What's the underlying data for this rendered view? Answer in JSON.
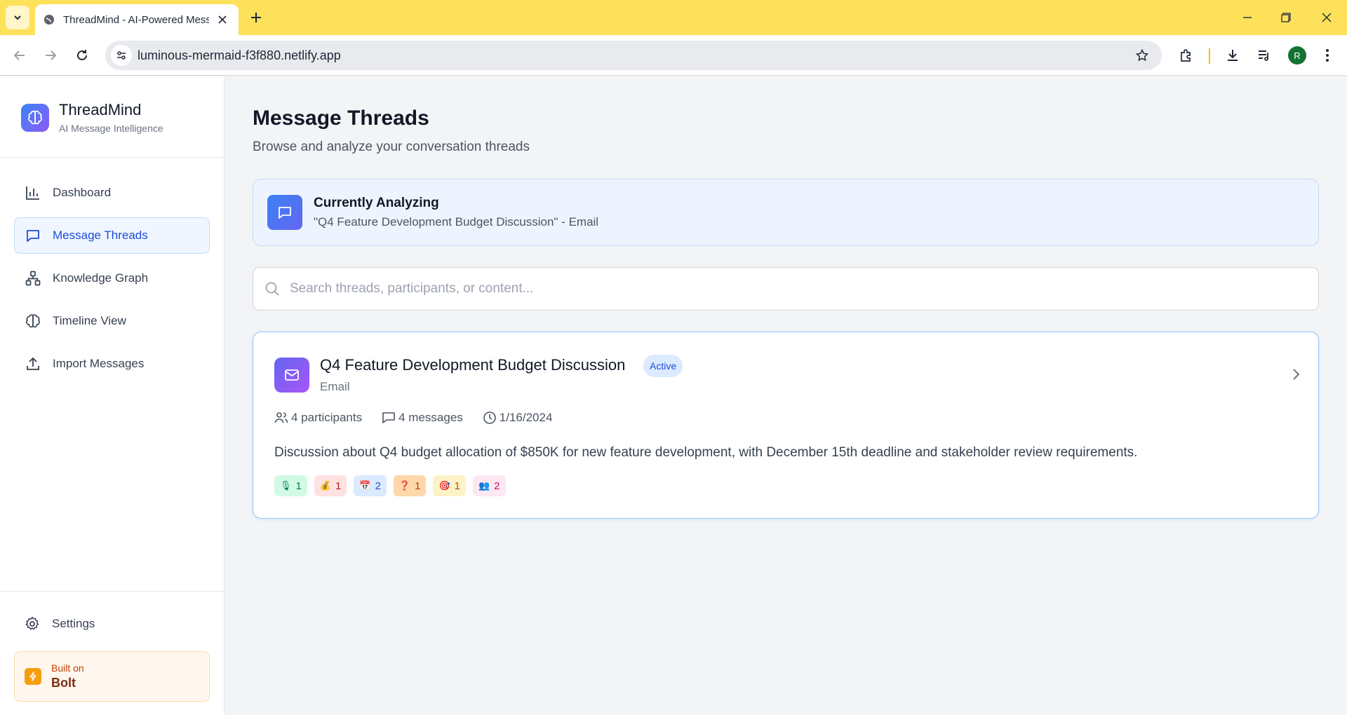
{
  "browser": {
    "tab_title": "ThreadMind - AI-Powered Mess",
    "url": "luminous-mermaid-f3f880.netlify.app",
    "profile_initial": "R"
  },
  "brand": {
    "title": "ThreadMind",
    "subtitle": "AI Message Intelligence"
  },
  "nav": [
    {
      "label": "Dashboard",
      "icon": "bar-chart-icon",
      "active": false
    },
    {
      "label": "Message Threads",
      "icon": "message-square-icon",
      "active": true
    },
    {
      "label": "Knowledge Graph",
      "icon": "network-icon",
      "active": false
    },
    {
      "label": "Timeline View",
      "icon": "brain-icon",
      "active": false
    },
    {
      "label": "Import Messages",
      "icon": "upload-icon",
      "active": false
    }
  ],
  "settings_label": "Settings",
  "bolt": {
    "small": "Built on",
    "big": "Bolt"
  },
  "page": {
    "title": "Message Threads",
    "subtitle": "Browse and analyze your conversation threads"
  },
  "analyzing": {
    "title": "Currently Analyzing",
    "subtitle": "\"Q4 Feature Development Budget Discussion\" - Email"
  },
  "search": {
    "placeholder": "Search threads, participants, or content...",
    "value": ""
  },
  "thread": {
    "title": "Q4 Feature Development Budget Discussion",
    "badge": "Active",
    "type": "Email",
    "participants": "4 participants",
    "messages": "4 messages",
    "date": "1/16/2024",
    "description": "Discussion about Q4 budget allocation of $850K for new feature development, with December 15th deadline and stakeholder review requirements.",
    "tags": [
      {
        "icon": "🎙",
        "count": "1",
        "bg": "#d1fae5",
        "fg": "#047857"
      },
      {
        "icon": "💰",
        "count": "1",
        "bg": "#fee2e2",
        "fg": "#b91c1c"
      },
      {
        "icon": "📅",
        "count": "2",
        "bg": "#dbeafe",
        "fg": "#1d4ed8"
      },
      {
        "icon": "❓",
        "count": "1",
        "bg": "#fed7aa",
        "fg": "#c2410c"
      },
      {
        "icon": "🎯",
        "count": "1",
        "bg": "#fef3c7",
        "fg": "#b45309"
      },
      {
        "icon": "👥",
        "count": "2",
        "bg": "#fce7f3",
        "fg": "#be185d"
      }
    ]
  },
  "colors": {
    "accent": "#1d4ed8",
    "active_bg": "#eff6ff",
    "chrome_tabbar": "#fde15b"
  }
}
